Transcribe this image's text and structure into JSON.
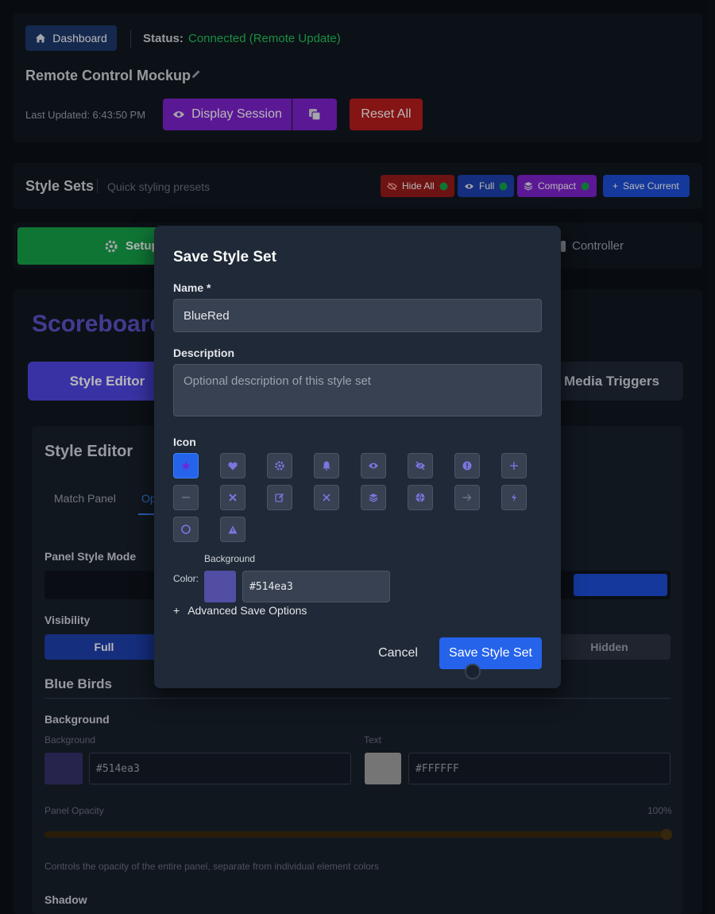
{
  "header": {
    "dashboard_label": "Dashboard",
    "status_label": "Status:",
    "status_value": "Connected (Remote Update)",
    "title": "Remote Control Mockup",
    "last_updated": "Last Updated: 6:43:50 PM",
    "display_session_label": "Display Session",
    "reset_all_label": "Reset All"
  },
  "style_sets": {
    "title": "Style Sets",
    "subtitle": "Quick styling presets",
    "buttons": {
      "hide_all": "Hide All",
      "full": "Full",
      "compact": "Compact",
      "save_current": "Save Current"
    }
  },
  "nav_tabs": {
    "setup": "Setup",
    "controller": "Controller"
  },
  "main": {
    "heading": "Scoreboard",
    "tabs": {
      "style_editor": "Style Editor",
      "media_triggers": "Media Triggers"
    },
    "editor": {
      "title": "Style Editor",
      "subtabs": [
        "Match Panel",
        "Op"
      ],
      "panel_style_mode_label": "Panel Style Mode",
      "visibility_label": "Visibility",
      "visibility_full": "Full",
      "visibility_hidden": "Hidden",
      "team_name": "Blue Birds",
      "background_section": "Background",
      "bg_label": "Background",
      "bg_value": "#514ea3",
      "text_label": "Text",
      "text_value": "#FFFFFF",
      "opacity_label": "Panel Opacity",
      "opacity_value": "100%",
      "opacity_help": "Controls the opacity of the entire panel, separate from individual element colors",
      "shadow_label": "Shadow"
    }
  },
  "modal": {
    "title": "Save Style Set",
    "name_label": "Name *",
    "name_value": "BlueRed",
    "description_label": "Description",
    "description_placeholder": "Optional description of this style set",
    "icon_label": "Icon",
    "icons": [
      "star-icon",
      "heart-icon",
      "gear-icon",
      "bell-icon",
      "eye-icon",
      "eye-off-icon",
      "alert-icon",
      "plus-icon",
      "minus-icon",
      "x-icon",
      "edit-icon",
      "close-icon",
      "layers-icon",
      "globe-icon",
      "arrow-right-icon",
      "bolt-icon",
      "circle-icon",
      "triangle-icon"
    ],
    "selected_icon": "star-icon",
    "color_label": "Color:",
    "color_sublabel": "Background",
    "color_value": "#514ea3",
    "advanced_label": "Advanced Save Options",
    "cancel_label": "Cancel",
    "save_label": "Save Style Set"
  },
  "colors": {
    "accent_blue": "#2563eb",
    "status_green": "#22c55e",
    "purple": "#7e22ce",
    "red": "#b91c1c",
    "swatch": "#514ea3",
    "scoreboard_title": "#5b54c9"
  }
}
